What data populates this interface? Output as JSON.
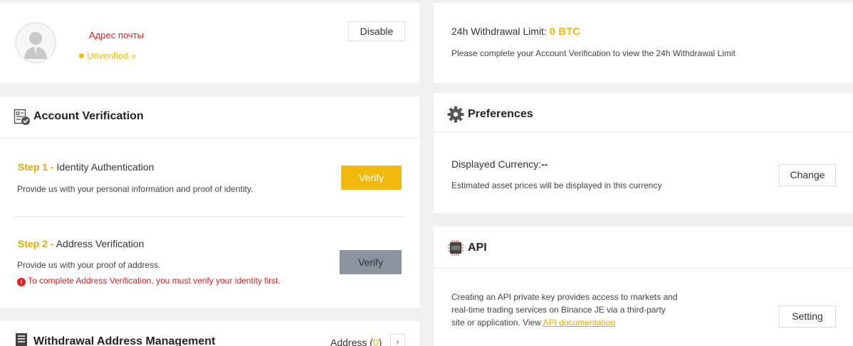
{
  "profile": {
    "email_label": "Адрес почты",
    "status": "Unverified »",
    "disable_label": "Disable"
  },
  "account_verification": {
    "title": "Account Verification",
    "step1": {
      "num": "Step 1 -",
      "name": "Identity Authentication",
      "desc": "Provide us with your personal information and proof of identity.",
      "button": "Verify"
    },
    "step2": {
      "num": "Step 2 -",
      "name": "Address Verification",
      "desc": "Provide us with your proof of address.",
      "warning": "To complete Address Verification, you must verify your identity first.",
      "button": "Verify"
    }
  },
  "withdrawal_address": {
    "title": "Withdrawal Address Management",
    "address_label": "Address (",
    "address_count": "0",
    "address_close": ")"
  },
  "withdrawal_limit": {
    "label": "24h Withdrawal Limit:",
    "value": "0 BTC",
    "desc": "Please complete your Account Verification to view the 24h Withdrawal Limit"
  },
  "preferences": {
    "title": "Preferences",
    "currency_label": "Displayed Currency:",
    "currency_value": "--",
    "desc": "Estimated asset prices will be displayed in this currency",
    "button": "Change"
  },
  "api": {
    "title": "API",
    "desc_line1": "Creating an API private key provides access to markets and",
    "desc_line2": "real-time trading services on Binance JE via a third-party",
    "desc_line3": "site or application. View ",
    "doc_link": "API documentation",
    "button": "Setting"
  },
  "colors": {
    "accent": "#f0b90b",
    "warning": "#e02020",
    "disabled_button": "#8c929e"
  }
}
